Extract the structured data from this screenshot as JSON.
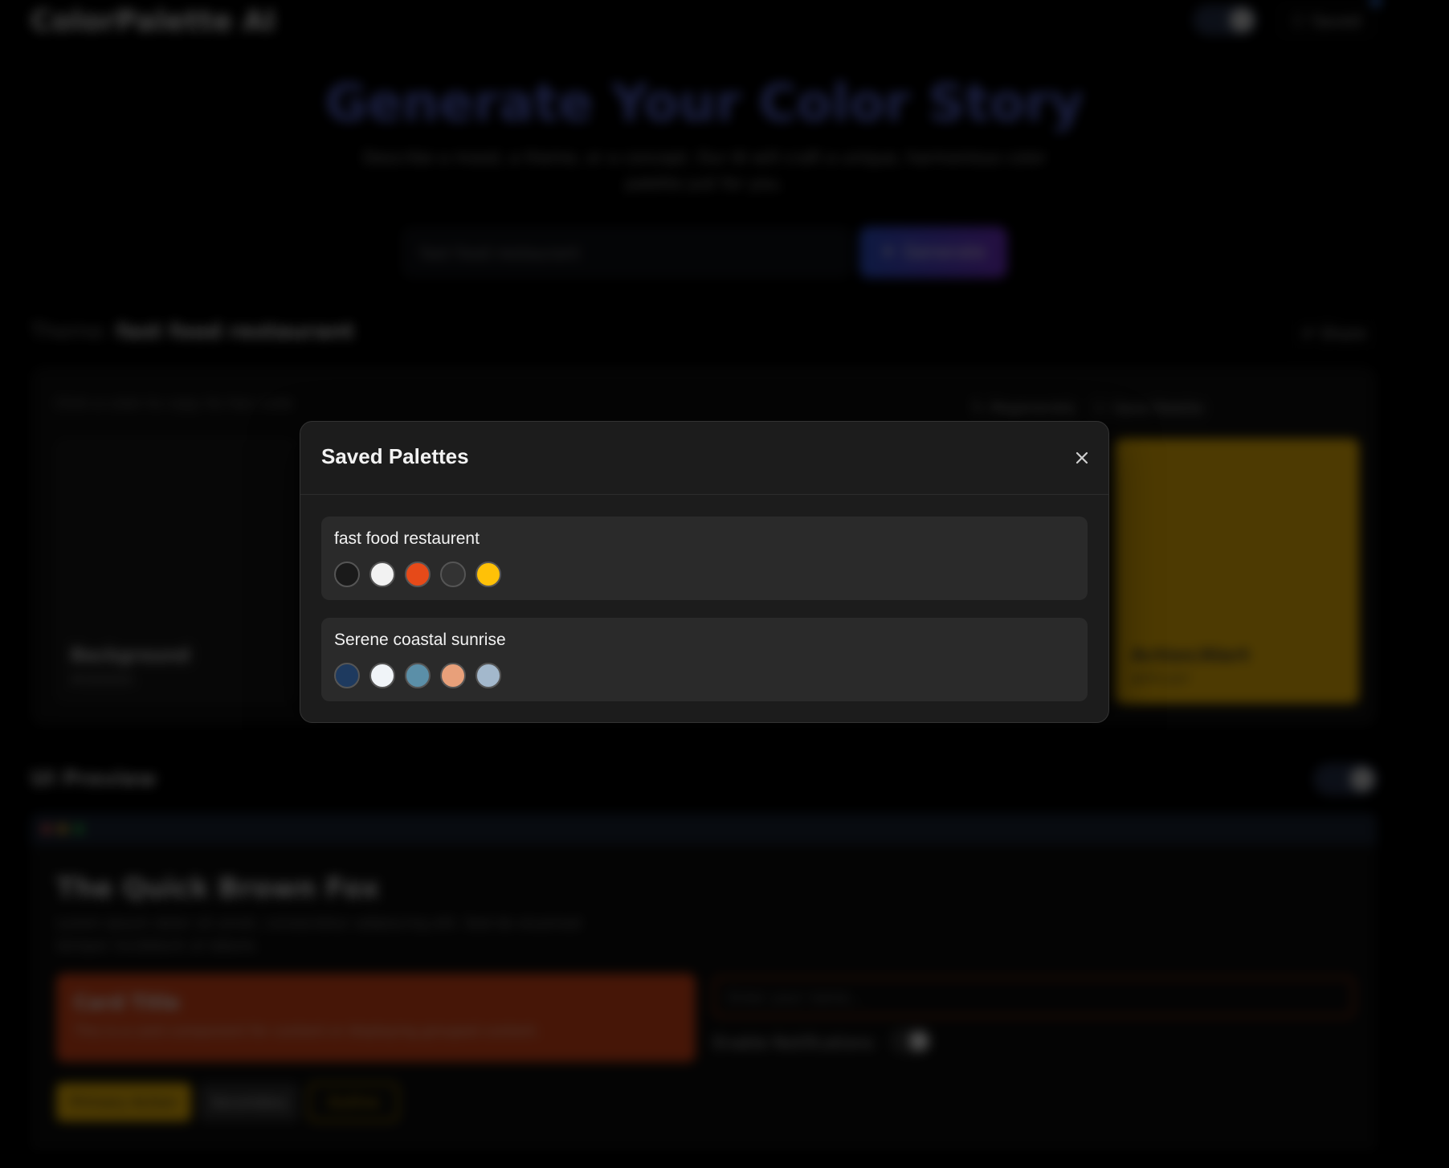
{
  "app": {
    "logo_text": "ColorPalette AI",
    "saved_label": "Saved",
    "hero_title": "Generate Your Color Story",
    "hero_subtitle": "Describe a mood, a theme, or a concept. Our AI will craft a unique, harmonious color palette just for you.",
    "search_value": "fast food restaurant",
    "generate_label": "Generate",
    "theme_prefix": "Theme:",
    "theme_value": "fast food restaurant",
    "share_label": "Share",
    "palette_hint": "Click a color to copy its hex code",
    "regenerate_label": "Regenerate",
    "save_label": "Save Palette",
    "swatch_left": {
      "name": "Background",
      "hex": "#1A1A1A"
    },
    "swatch_right": {
      "name": "Action/Alert",
      "hex": "#FFC107"
    },
    "preview_title": "UI Preview",
    "preview": {
      "heading": "The Quick Brown Fox",
      "description": "Lorem ipsum dolor sit amet, consectetur adipiscing elit. Sed do eiusmod tempor incididunt ut labore.",
      "card_title": "Card Title",
      "card_text": "This is a card component for content or displaying grouped content.",
      "input_placeholder": "Enter your name...",
      "notif_label": "Enable Notifications",
      "primary_label": "Primary Action",
      "secondary_label": "Secondary",
      "outline_label": "Outline"
    }
  },
  "modal": {
    "title": "Saved Palettes",
    "palettes": [
      {
        "name": "fast food restaurent",
        "colors": [
          "#1a1a1a",
          "#f2f2f2",
          "#e64a19",
          "#333333",
          "#ffc107"
        ]
      },
      {
        "name": "Serene coastal sunrise",
        "colors": [
          "#1e3a5f",
          "#f0f4f8",
          "#5b8fa8",
          "#e8a07a",
          "#a3b8cc"
        ]
      }
    ]
  },
  "icons": [
    "close-icon",
    "bookmark-icon",
    "sparkle-icon",
    "share-icon",
    "pencil-icon"
  ]
}
